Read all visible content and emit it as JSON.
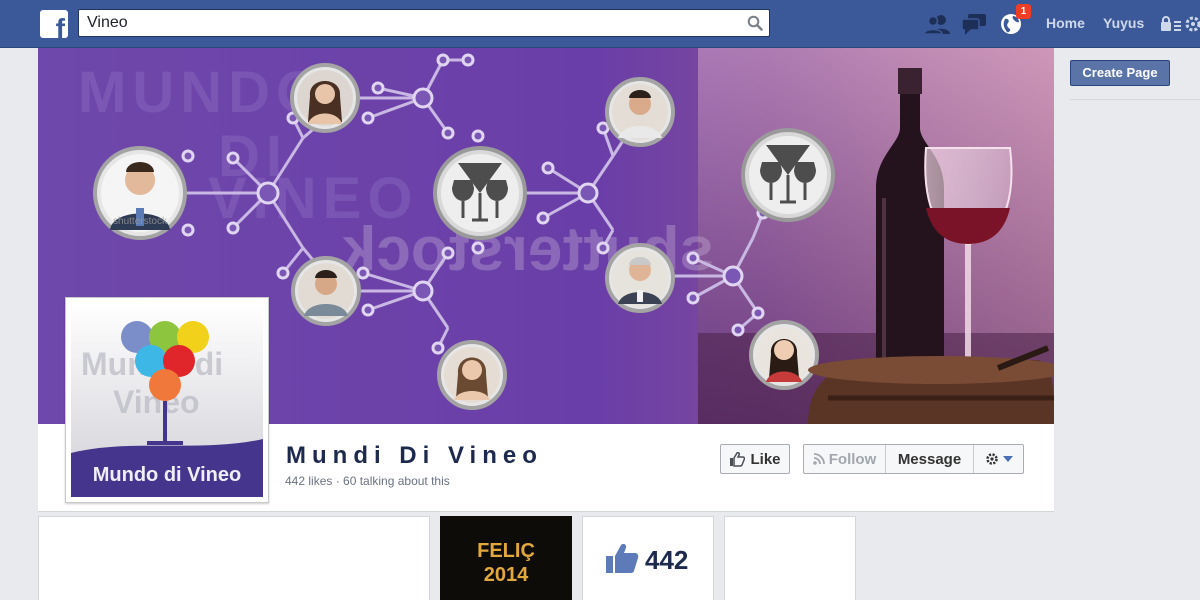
{
  "topbar": {
    "logo_letter": "f",
    "search_value": "Vineo",
    "notifications_count": "1",
    "nav_home": "Home",
    "nav_user": "Yuyus"
  },
  "right_column": {
    "create_page_label": "Create Page"
  },
  "cover": {
    "watermark_lines": [
      "MUNDO",
      "DI",
      "VINEO"
    ],
    "shutterstock_text": "shutterstock",
    "avatar_watermark": "shutterstock"
  },
  "profile": {
    "logo_text": "Mundo di Vineo",
    "logo_ghost_text_1": "Mundo di",
    "logo_ghost_text_2": "Vineo",
    "page_name": "Mundi Di Vineo",
    "stats": "442 likes · 60 talking about this"
  },
  "actions": {
    "like_label": "Like",
    "follow_label": "Follow",
    "message_label": "Message"
  },
  "content": {
    "photo_line_1": "FELIÇ",
    "photo_line_2": "2014",
    "likes_count": "442"
  },
  "colors": {
    "facebook_blue": "#3b5998",
    "cover_purple": "#6a3fa4",
    "logo_band": "#45358c"
  }
}
